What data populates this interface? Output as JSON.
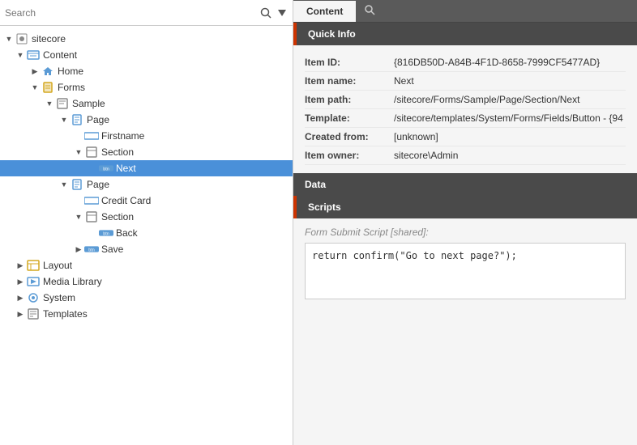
{
  "search": {
    "placeholder": "Search",
    "value": ""
  },
  "tree": {
    "nodes": [
      {
        "id": "sitecore",
        "label": "sitecore",
        "level": 0,
        "icon": "globe",
        "expanded": true
      },
      {
        "id": "content",
        "label": "Content",
        "level": 1,
        "icon": "content",
        "expanded": true
      },
      {
        "id": "home",
        "label": "Home",
        "level": 2,
        "icon": "home",
        "expanded": false
      },
      {
        "id": "forms",
        "label": "Forms",
        "level": 2,
        "icon": "forms",
        "expanded": true
      },
      {
        "id": "sample",
        "label": "Sample",
        "level": 3,
        "icon": "sample",
        "expanded": true
      },
      {
        "id": "page1",
        "label": "Page",
        "level": 4,
        "icon": "page",
        "expanded": true
      },
      {
        "id": "firstname",
        "label": "Firstname",
        "level": 5,
        "icon": "field",
        "expanded": false
      },
      {
        "id": "section1",
        "label": "Section",
        "level": 5,
        "icon": "section",
        "expanded": true
      },
      {
        "id": "next",
        "label": "Next",
        "level": 6,
        "icon": "button",
        "expanded": false,
        "selected": true
      },
      {
        "id": "page2",
        "label": "Page",
        "level": 4,
        "icon": "page",
        "expanded": true
      },
      {
        "id": "creditcard",
        "label": "Credit Card",
        "level": 5,
        "icon": "field",
        "expanded": false
      },
      {
        "id": "section2",
        "label": "Section",
        "level": 5,
        "icon": "section",
        "expanded": true
      },
      {
        "id": "back",
        "label": "Back",
        "level": 6,
        "icon": "button",
        "expanded": false
      },
      {
        "id": "save",
        "label": "Save",
        "level": 5,
        "icon": "button",
        "expanded": false
      },
      {
        "id": "layout",
        "label": "Layout",
        "level": 1,
        "icon": "layout",
        "expanded": false
      },
      {
        "id": "medialibrary",
        "label": "Media Library",
        "level": 1,
        "icon": "media",
        "expanded": false
      },
      {
        "id": "system",
        "label": "System",
        "level": 1,
        "icon": "system",
        "expanded": false
      },
      {
        "id": "templates",
        "label": "Templates",
        "level": 1,
        "icon": "templates",
        "expanded": false
      }
    ]
  },
  "tabs": [
    {
      "id": "content",
      "label": "Content",
      "active": true
    },
    {
      "id": "search",
      "label": "",
      "icon": "search"
    }
  ],
  "quickinfo": {
    "title": "Quick Info",
    "fields": [
      {
        "label": "Item ID:",
        "value": "{816DB50D-A84B-4F1D-8658-7999CF5477AD}"
      },
      {
        "label": "Item name:",
        "value": "Next"
      },
      {
        "label": "Item path:",
        "value": "/sitecore/Forms/Sample/Page/Section/Next"
      },
      {
        "label": "Template:",
        "value": "/sitecore/templates/System/Forms/Fields/Button - {94"
      },
      {
        "label": "Created from:",
        "value": "[unknown]"
      },
      {
        "label": "Item owner:",
        "value": "sitecore\\Admin"
      }
    ]
  },
  "data_section": {
    "title": "Data"
  },
  "scripts_section": {
    "title": "Scripts",
    "form_submit_label": "Form Submit Script",
    "shared_label": "[shared]:",
    "script_value": "return confirm(\"Go to next page?\");"
  }
}
